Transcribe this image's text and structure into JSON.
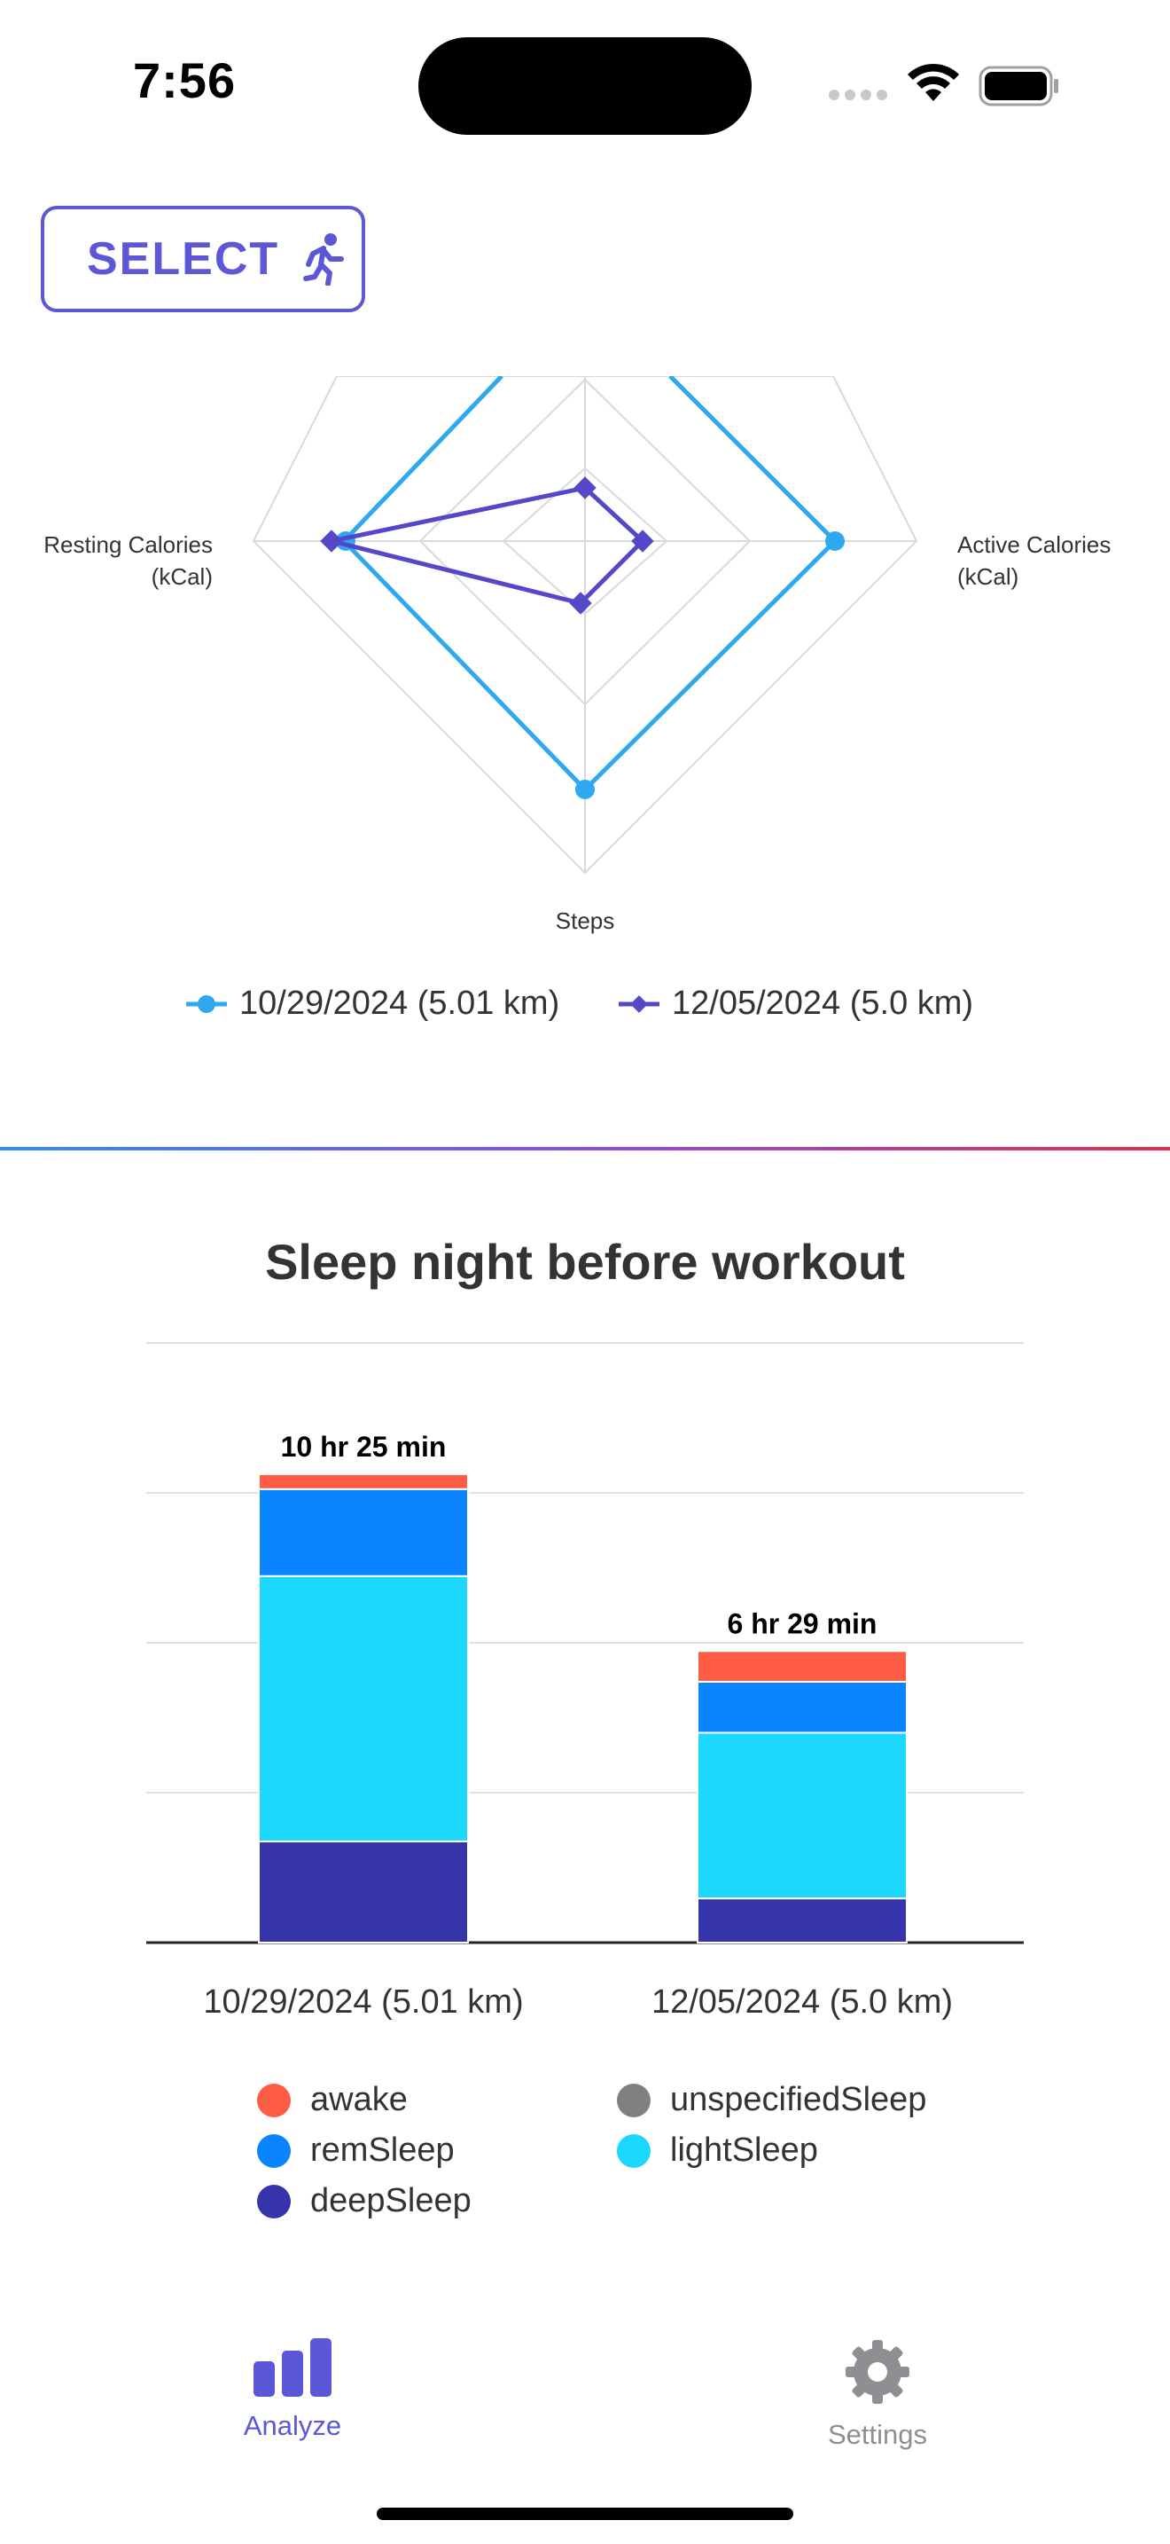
{
  "status": {
    "time": "7:56"
  },
  "select_button": {
    "label": "SELECT",
    "icon": "running-figure-icon"
  },
  "radar": {
    "axis_labels": {
      "resting": "Resting Calories\n(kCal)",
      "active": "Active Calories\n(kCal)",
      "steps": "Steps"
    },
    "legend": [
      "10/29/2024 (5.01 km)",
      "12/05/2024 (5.0 km)"
    ],
    "colors": [
      "#2ea8f0",
      "#5448c8"
    ]
  },
  "sleep": {
    "title": "Sleep night before workout",
    "categories": [
      "10/29/2024 (5.01 km)",
      "12/05/2024 (5.0 km)"
    ],
    "totals": [
      "10 hr 25 min",
      "6 hr 29 min"
    ],
    "legend": [
      {
        "label": "awake",
        "color": "#ff5c45"
      },
      {
        "label": "unspecifiedSleep",
        "color": "#808080"
      },
      {
        "label": "remSleep",
        "color": "#0a84ff"
      },
      {
        "label": "lightSleep",
        "color": "#1dd8fd"
      },
      {
        "label": "deepSleep",
        "color": "#3634aa"
      }
    ]
  },
  "chart_data": {
    "type": "bar",
    "title": "Sleep night before workout",
    "categories": [
      "10/29/2024 (5.01 km)",
      "12/05/2024 (5.0 km)"
    ],
    "stacked": true,
    "series": [
      {
        "name": "deepSleep",
        "values": [
          135,
          59
        ]
      },
      {
        "name": "lightSleep",
        "values": [
          354,
          221
        ]
      },
      {
        "name": "remSleep",
        "values": [
          116,
          68
        ]
      },
      {
        "name": "awake",
        "values": [
          20,
          41
        ]
      },
      {
        "name": "unspecifiedSleep",
        "values": [
          0,
          0
        ]
      }
    ],
    "data_labels": [
      "10 hr 25 min",
      "6 hr 29 min"
    ],
    "ylim": [
      0,
      800
    ],
    "grid": true
  },
  "tabs": [
    {
      "label": "Analyze",
      "icon": "bar-chart-icon",
      "active": true,
      "color": "#5b57d6"
    },
    {
      "label": "Settings",
      "icon": "gear-icon",
      "active": false,
      "color": "#8e8e93"
    }
  ]
}
